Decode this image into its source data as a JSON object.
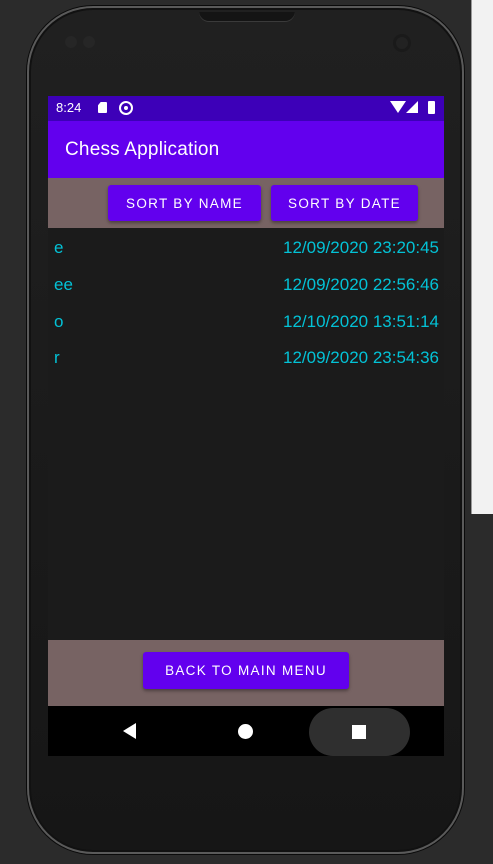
{
  "status_bar": {
    "time": "8:24"
  },
  "app_bar": {
    "title": "Chess Application"
  },
  "sort_buttons": {
    "by_name": "SORT BY NAME",
    "by_date": "SORT BY DATE"
  },
  "games": [
    {
      "name": "e",
      "date": "12/09/2020 23:20:45"
    },
    {
      "name": "ee",
      "date": "12/09/2020 22:56:46"
    },
    {
      "name": "o",
      "date": "12/10/2020 13:51:14"
    },
    {
      "name": "r",
      "date": "12/09/2020 23:54:36"
    }
  ],
  "bottom": {
    "back_label": "BACK TO MAIN MENU"
  },
  "colors": {
    "status_bar": "#3d00b8",
    "app_bar": "#6200ee",
    "button": "#6200ee",
    "panel": "#776363",
    "list_text": "#03c2d6",
    "screen_bg": "#1b1b1b"
  },
  "icons": {
    "status": [
      "sd-card-icon",
      "sync-icon",
      "wifi-icon",
      "signal-icon",
      "battery-icon"
    ],
    "nav": [
      "back-icon",
      "home-icon",
      "recents-icon"
    ]
  }
}
